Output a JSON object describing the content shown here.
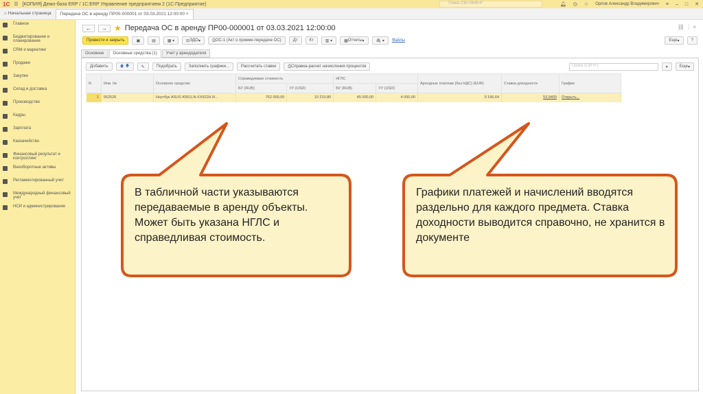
{
  "titlebar": {
    "logo": "1С",
    "title": "[КОПИЯ] Демо-база ERP / 1С:ERP Управление предприятием 2  (1С:Предприятие)",
    "search_placeholder": "Поиск Ctrl+Shift+F",
    "user": "Орлов Александр Владимирович"
  },
  "tabs": [
    "Начальная страница",
    "Передача ОС в аренду ПР00-000001 от 03.03.2021 12:00:00"
  ],
  "sidebar": [
    "Главное",
    "Бюджетирование и планирование",
    "CRM и маркетинг",
    "Продажи",
    "Закупки",
    "Склад и доставка",
    "Производство",
    "Кадры",
    "Зарплата",
    "Казначейство",
    "Финансовый результат и контроллинг",
    "Внеоборотные активы",
    "Регламентированный учет",
    "Международный финансовый учет",
    "НСИ и администрирование"
  ],
  "document": {
    "title": "Передача ОС в аренду ПР00-000001 от 03.03.2021 12:00:00",
    "toolbar": {
      "post_close": "Провести и закрыть",
      "edo": "ЭДО",
      "print": "ОС-1 (Акт о приеме-передаче ОС)",
      "reports": "Отчеты",
      "files": "Файлы",
      "more": "Еще",
      "help": "?"
    },
    "tabs": [
      "Основное",
      "Основные средства (1)",
      "Учет у арендодателя"
    ],
    "table_toolbar": {
      "add": "Добавить",
      "pick": "Подобрать",
      "fill": "Заполнить графики...",
      "calc": "Рассчитать ставки",
      "report": "Справка-расчет начисления процентов",
      "search_placeholder": "Поиск (Ctrl+F)",
      "more": "Еще"
    },
    "columns": {
      "n": "N",
      "inv": "Инв. №",
      "asset": "Основное средство",
      "fair": "Справедливая стоимость",
      "nglс": "НГЛС",
      "bu": "БУ (RUB)",
      "uu": "УУ (USD)",
      "payments": "Арендные платежи (без НДС) (EUR)",
      "rate": "Ставка доходности",
      "schedule": "График"
    },
    "rows": [
      {
        "n": "1",
        "inv": "552526",
        "asset": "Ноутбук ASUS K551LN-XX522H И...",
        "fair_bu": "762 000,00",
        "fair_uu": "10 210,80",
        "ngls_bu": "45 000,00",
        "ngls_uu": "4 000,00",
        "payments": "9 166,64",
        "rate": "53,9409",
        "schedule": "Открыть..."
      }
    ]
  },
  "callouts": {
    "left": "В табличной части указываются передаваемые в аренду объекты. Может быть указана НГЛС и справедливая стоимость.",
    "right": "Графики платежей и начислений вводятся раздельно для каждого предмета. Ставка доходности выводится справочно, не хранится в документе"
  },
  "colors": {
    "callout_border": "#d4561c",
    "callout_fill": "#fdf3c8",
    "sidebar": "#fbeda4",
    "primary_button": "#fde545"
  }
}
